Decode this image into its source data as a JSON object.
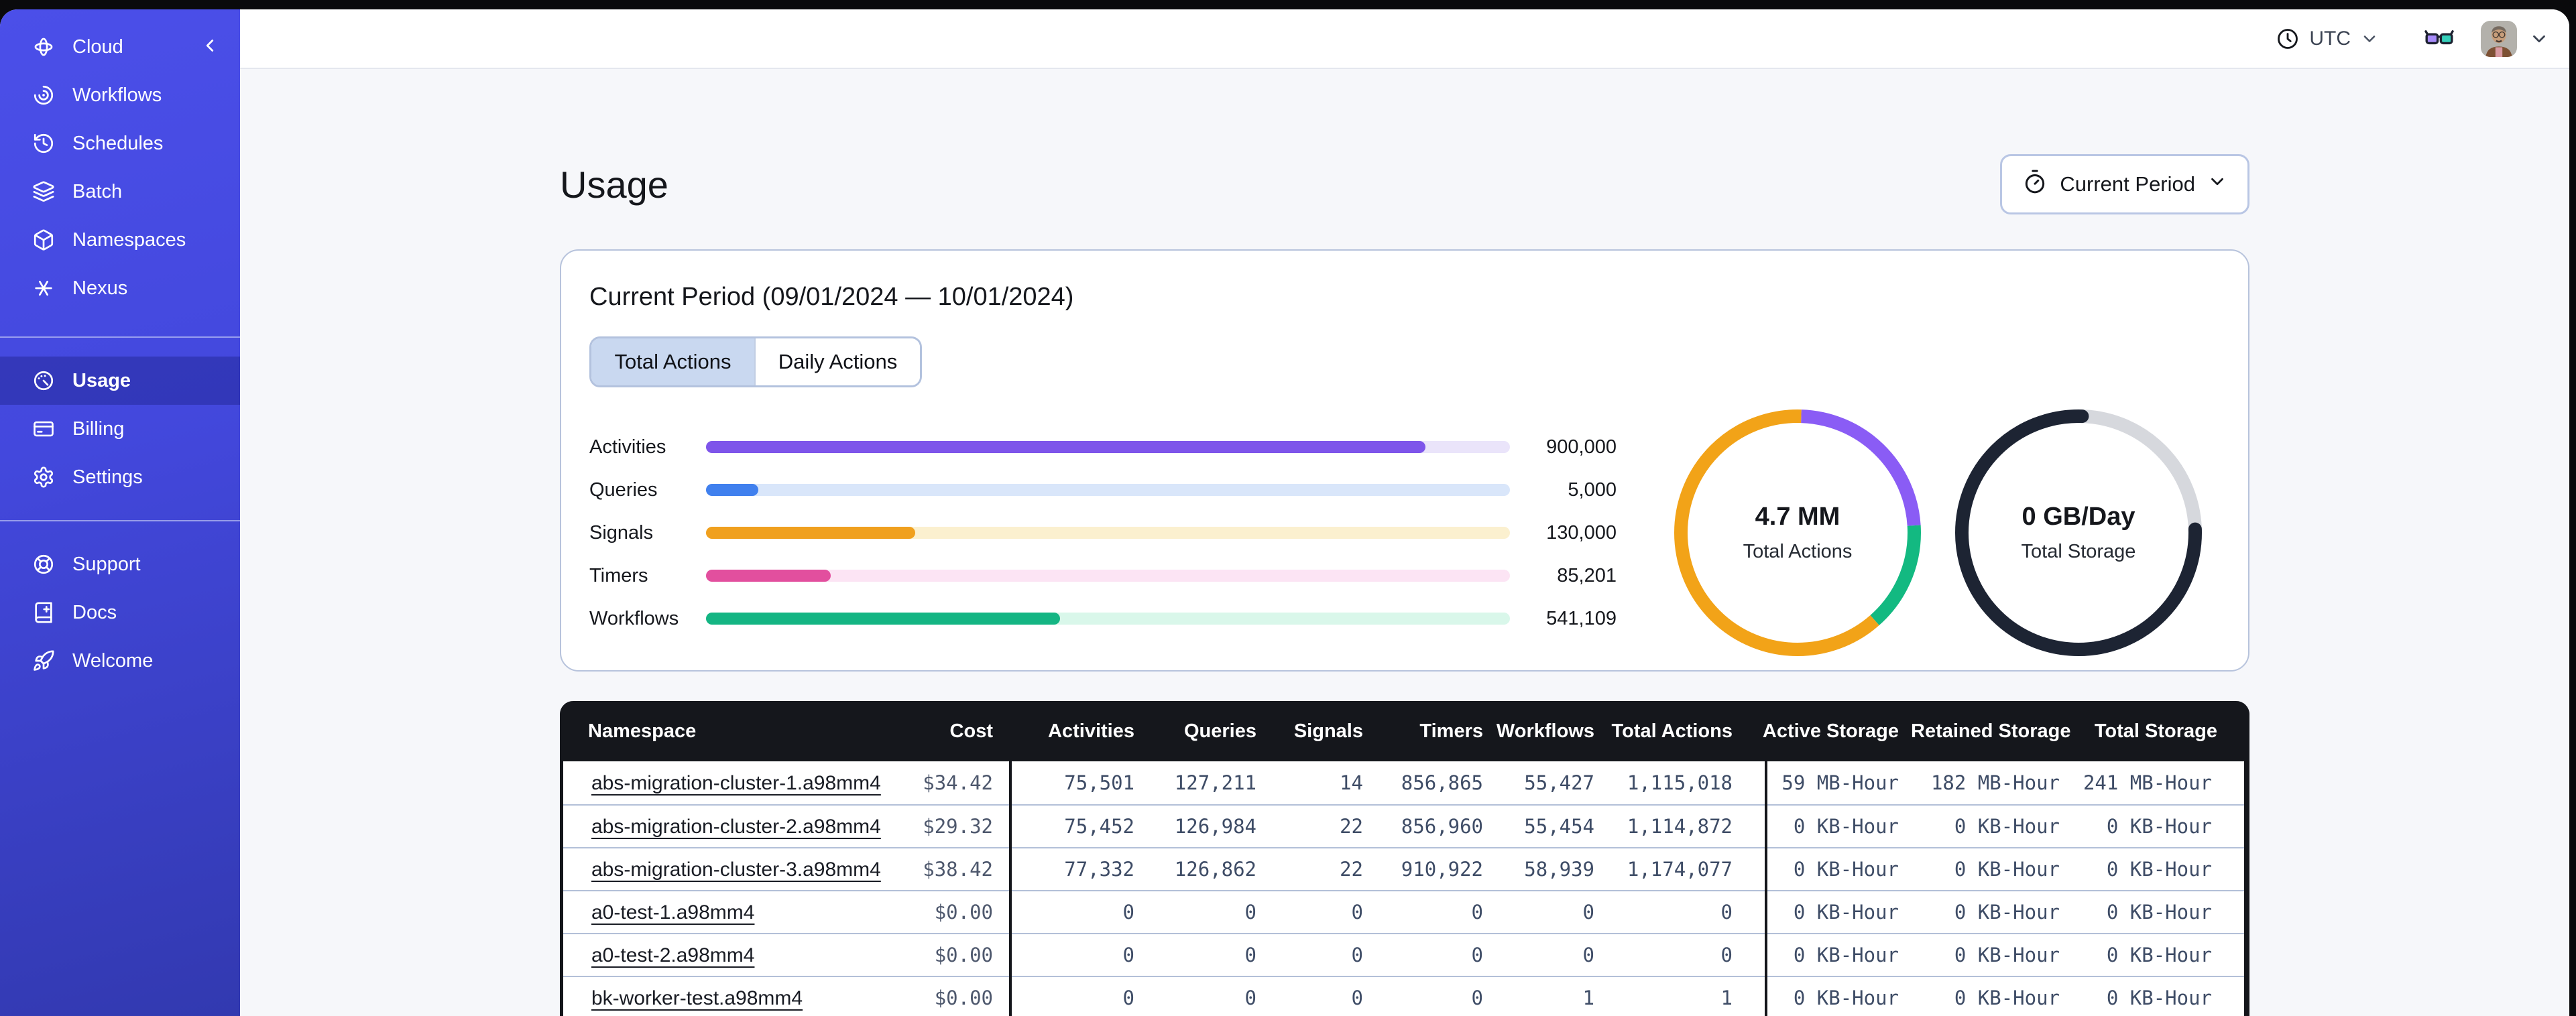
{
  "sidebar": {
    "brand_label": "Cloud",
    "sections": [
      {
        "items": [
          {
            "icon": "workflows",
            "label": "Workflows",
            "active": false
          },
          {
            "icon": "schedules",
            "label": "Schedules",
            "active": false
          },
          {
            "icon": "batch",
            "label": "Batch",
            "active": false
          },
          {
            "icon": "namespaces",
            "label": "Namespaces",
            "active": false
          },
          {
            "icon": "nexus",
            "label": "Nexus",
            "active": false
          }
        ]
      },
      {
        "items": [
          {
            "icon": "usage",
            "label": "Usage",
            "active": true
          },
          {
            "icon": "billing",
            "label": "Billing",
            "active": false
          },
          {
            "icon": "settings",
            "label": "Settings",
            "active": false
          }
        ]
      },
      {
        "items": [
          {
            "icon": "support",
            "label": "Support",
            "active": false
          },
          {
            "icon": "docs",
            "label": "Docs",
            "active": false
          },
          {
            "icon": "welcome",
            "label": "Welcome",
            "active": false
          }
        ]
      }
    ]
  },
  "topbar": {
    "timezone_label": "UTC"
  },
  "page": {
    "title": "Usage",
    "period_selector_label": "Current Period"
  },
  "usage_card": {
    "heading": "Current Period (09/01/2024 — 10/01/2024)",
    "tabs": [
      {
        "label": "Total Actions",
        "active": true
      },
      {
        "label": "Daily Actions",
        "active": false
      }
    ]
  },
  "chart_data": [
    {
      "type": "bar",
      "title": "Current period usage by action type",
      "orientation": "horizontal",
      "categories": [
        "Activities",
        "Queries",
        "Signals",
        "Timers",
        "Workflows"
      ],
      "values": [
        900000,
        5000,
        130000,
        85201,
        541109
      ],
      "value_labels": [
        "900,000",
        "5,000",
        "130,000",
        "85,201",
        "541,109"
      ],
      "bar_fill_fractions": [
        0.895,
        0.065,
        0.26,
        0.155,
        0.44
      ],
      "bar_colors": [
        "#7e55ea",
        "#4080ee",
        "#f0a01e",
        "#e24f9e",
        "#14b583"
      ],
      "track_colors": [
        "#eae4fa",
        "#d9e6fa",
        "#fbf0cf",
        "#fce4f4",
        "#d9f7ea"
      ]
    },
    {
      "type": "donut",
      "center_value": "4.7 MM",
      "center_label": "Total Actions",
      "segments": [
        {
          "name": "segment-1",
          "color": "#8a5cf5",
          "start_pct": 0.5,
          "length_pct": 23.5,
          "round_cap": false
        },
        {
          "name": "segment-2",
          "color": "#13b981",
          "start_pct": 24,
          "length_pct": 14.5,
          "round_cap": false
        },
        {
          "name": "segment-3",
          "color": "#f2a318",
          "start_pct": 38.5,
          "length_pct": 62,
          "round_cap": false
        }
      ]
    },
    {
      "type": "donut",
      "center_value": "0 GB/Day",
      "center_label": "Total Storage",
      "segments": [
        {
          "name": "track",
          "color": "#d6d8dd",
          "start_pct": 0,
          "length_pct": 100,
          "round_cap": false
        },
        {
          "name": "storage",
          "color": "#1d2433",
          "start_pct": 24.5,
          "length_pct": 76,
          "round_cap": true
        }
      ]
    }
  ],
  "table": {
    "headers": [
      "Namespace",
      "Cost",
      "Activities",
      "Queries",
      "Signals",
      "Timers",
      "Workflows",
      "Total Actions",
      "Active Storage",
      "Retained Storage",
      "Total Storage"
    ],
    "rows": [
      [
        "abs-migration-cluster-1.a98mm4",
        "$34.42",
        "75,501",
        "127,211",
        "14",
        "856,865",
        "55,427",
        "1,115,018",
        "59 MB-Hour",
        "182 MB-Hour",
        "241 MB-Hour"
      ],
      [
        "abs-migration-cluster-2.a98mm4",
        "$29.32",
        "75,452",
        "126,984",
        "22",
        "856,960",
        "55,454",
        "1,114,872",
        "0 KB-Hour",
        "0 KB-Hour",
        "0 KB-Hour"
      ],
      [
        "abs-migration-cluster-3.a98mm4",
        "$38.42",
        "77,332",
        "126,862",
        "22",
        "910,922",
        "58,939",
        "1,174,077",
        "0 KB-Hour",
        "0 KB-Hour",
        "0 KB-Hour"
      ],
      [
        "a0-test-1.a98mm4",
        "$0.00",
        "0",
        "0",
        "0",
        "0",
        "0",
        "0",
        "0 KB-Hour",
        "0 KB-Hour",
        "0 KB-Hour"
      ],
      [
        "a0-test-2.a98mm4",
        "$0.00",
        "0",
        "0",
        "0",
        "0",
        "0",
        "0",
        "0 KB-Hour",
        "0 KB-Hour",
        "0 KB-Hour"
      ],
      [
        "bk-worker-test.a98mm4",
        "$0.00",
        "0",
        "0",
        "0",
        "0",
        "1",
        "1",
        "0 KB-Hour",
        "0 KB-Hour",
        "0 KB-Hour"
      ]
    ]
  }
}
